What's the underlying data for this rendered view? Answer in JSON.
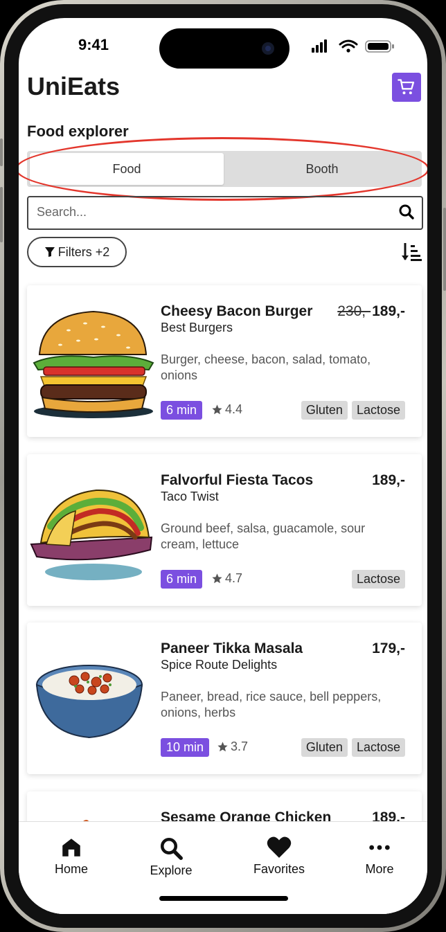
{
  "status_bar": {
    "time": "9:41"
  },
  "header": {
    "app_title": "UniEats"
  },
  "section_title": "Food explorer",
  "segmented": {
    "options": [
      "Food",
      "Booth"
    ],
    "selected": "Food"
  },
  "search": {
    "placeholder": "Search...",
    "value": ""
  },
  "filters": {
    "label": "Filters +2"
  },
  "colors": {
    "accent": "#7b4fe0",
    "annotation": "#e3362c",
    "tag_bg": "#d9d9d9"
  },
  "items": [
    {
      "name": "Cheesy Bacon Burger",
      "old_price": "230,-",
      "price": "189,-",
      "booth": "Best Burgers",
      "description": "Burger, cheese, bacon, salad, tomato, onions",
      "time": "6 min",
      "rating": "4.4",
      "tags": [
        "Gluten",
        "Lactose"
      ],
      "image": "burger-illustration"
    },
    {
      "name": "Falvorful Fiesta Tacos",
      "price": "189,-",
      "booth": "Taco Twist",
      "description": "Ground beef, salsa, guacamole, sour cream, lettuce",
      "time": "6 min",
      "rating": "4.7",
      "tags": [
        "Lactose"
      ],
      "image": "tacos-illustration"
    },
    {
      "name": "Paneer Tikka Masala",
      "price": "179,-",
      "booth": "Spice Route Delights",
      "description": "Paneer, bread, rice sauce, bell peppers, onions, herbs",
      "time": "10 min",
      "rating": "3.7",
      "tags": [
        "Gluten",
        "Lactose"
      ],
      "image": "curry-bowl-illustration"
    },
    {
      "name": "Sesame Orange Chicken",
      "price": "189,-"
    }
  ],
  "tabbar": {
    "tabs": [
      {
        "label": "Home",
        "icon": "home-icon"
      },
      {
        "label": "Explore",
        "icon": "search-icon"
      },
      {
        "label": "Favorites",
        "icon": "heart-icon"
      },
      {
        "label": "More",
        "icon": "more-dots-icon"
      }
    ]
  }
}
